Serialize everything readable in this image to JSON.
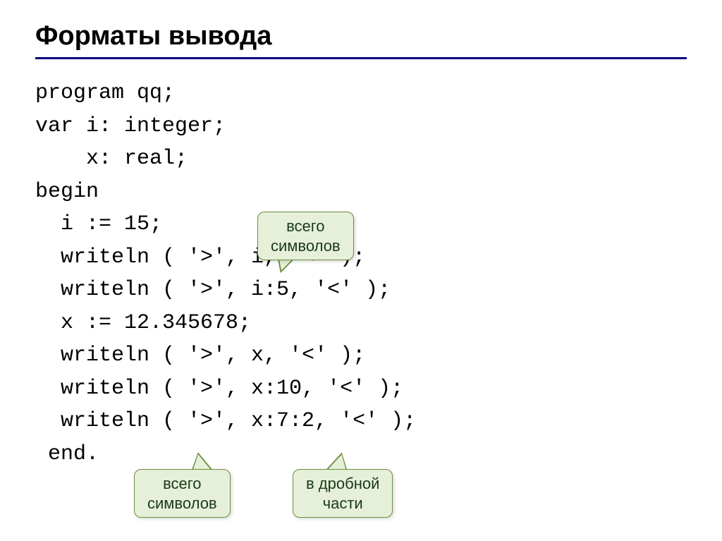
{
  "title": "Форматы вывода",
  "code_lines": {
    "l1": "program qq;",
    "l2": "var i: integer;",
    "l3": "    x: real;",
    "l4": "begin",
    "l5": "  i := 15;",
    "l6": "  writeln ( '>', i, '<' );",
    "l7": "  writeln ( '>', i:5, '<' );",
    "l8": "  x := 12.345678;",
    "l9": "  writeln ( '>', x, '<' );",
    "l10": "  writeln ( '>', x:10, '<' );",
    "l11": "  writeln ( '>', x:7:2, '<' );",
    "l12": " end."
  },
  "callouts": {
    "c1_line1": "всего",
    "c1_line2": "символов",
    "c2_line1": "всего",
    "c2_line2": "символов",
    "c3_line1": "в дробной",
    "c3_line2": "части"
  }
}
